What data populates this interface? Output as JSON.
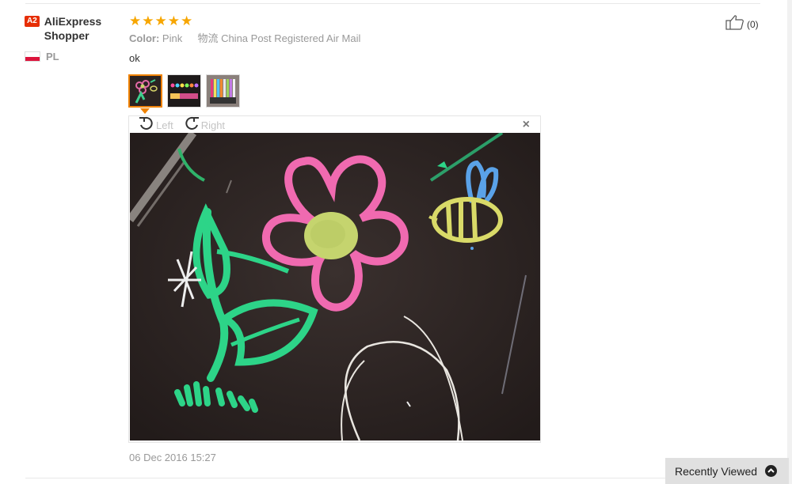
{
  "review": {
    "user": {
      "level_badge": "A2",
      "name": "AliExpress Shopper",
      "country_code": "PL"
    },
    "rating": 5,
    "attributes": {
      "color_key": "Color:",
      "color_value": "Pink",
      "shipping": "物流 China Post Registered Air Mail"
    },
    "feedback_text": "ok",
    "date": "06 Dec 2016 15:27",
    "helpful": {
      "count_label": "(0)"
    },
    "thumbnails": [
      {
        "name": "thumb-chalk-flower",
        "active": true
      },
      {
        "name": "thumb-aliexpress-chalk-text",
        "active": false
      },
      {
        "name": "thumb-marker-set",
        "active": false
      }
    ],
    "viewer": {
      "rotate_left_label": "Left",
      "rotate_right_label": "Right",
      "close_icon": "close-icon"
    }
  },
  "recently_viewed": {
    "label": "Recently Viewed",
    "icon": "chevron-up-circle-icon"
  },
  "colors": {
    "star": "#f7a600",
    "badge": "#e62e04",
    "active_thumb": "#f08200"
  }
}
